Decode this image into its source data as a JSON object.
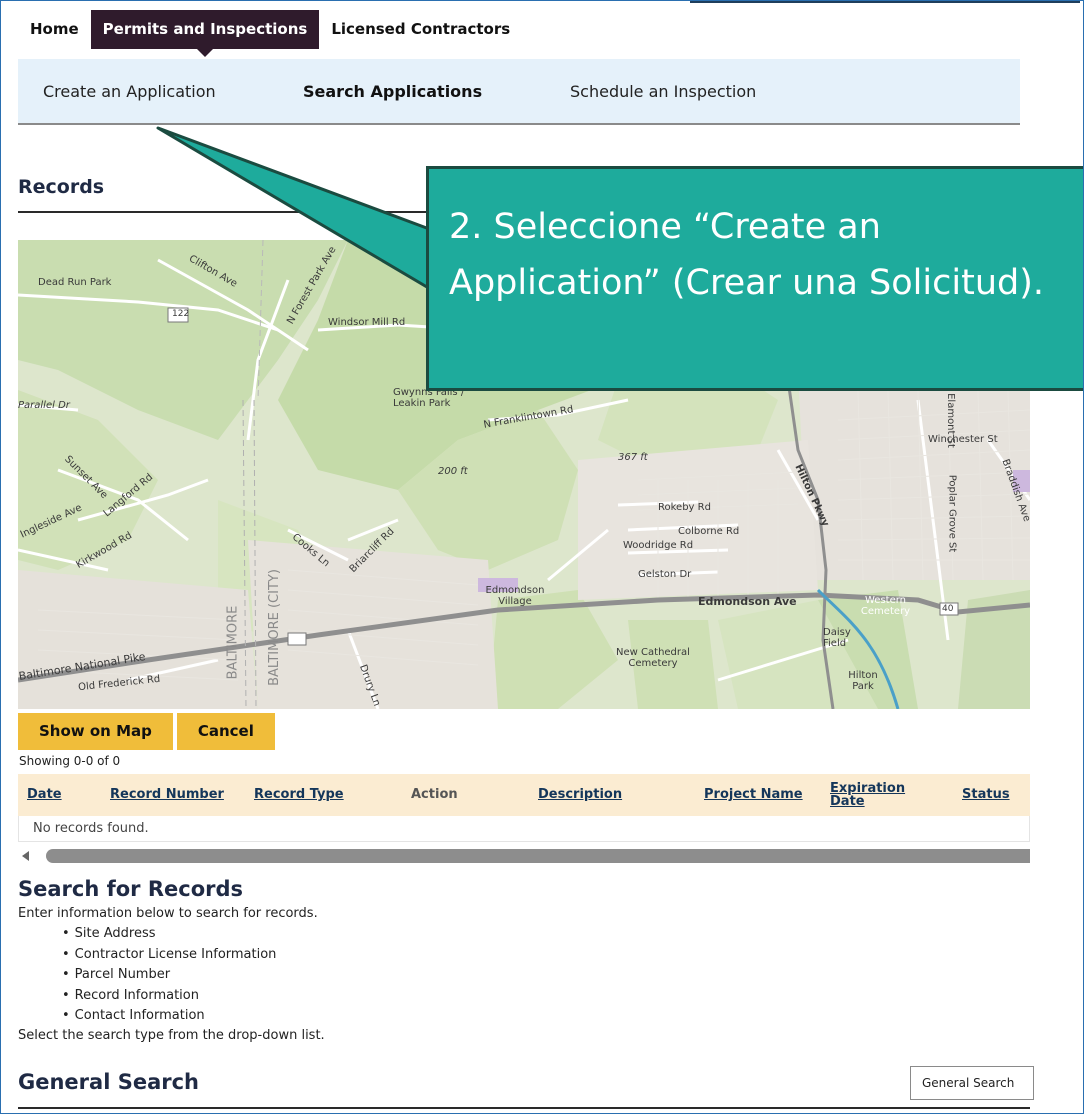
{
  "nav": {
    "home": "Home",
    "permits": "Permits and Inspections",
    "contractors": "Licensed Contractors"
  },
  "subnav": {
    "create": "Create an Application",
    "search": "Search Applications",
    "schedule": "Schedule an Inspection"
  },
  "records": {
    "title": "Records"
  },
  "callout": {
    "text": "2. Seleccione “Create an Application”  (Crear una Solicitud)."
  },
  "map": {
    "labels": [
      "Dead Run Park",
      "Clifton Ave",
      "N Forest Park Ave",
      "Windsor Mill Rd",
      "122",
      "Parallel Dr",
      "Gwynns Falls / Leakin Park",
      "N Franklintown Rd",
      "200 ft",
      "367 ft",
      "Elamont St",
      "Winchester St",
      "Sunset Ave",
      "Langford Rd",
      "Ingleside Ave",
      "Kirkwood Rd",
      "Cooks Ln",
      "Briarcliff Rd",
      "Rokeby Rd",
      "Colborne Rd",
      "Woodridge Rd",
      "Gelston Dr",
      "Hilton Pkwy",
      "Poplar Grove St",
      "Braddish Ave",
      "Edmondson Village",
      "Edmondson Ave",
      "Western Cemetery",
      "40",
      "Daisy Field",
      "New Cathedral Cemetery",
      "Hilton Park",
      "Baltimore National Pike",
      "Old Frederick Rd",
      "BALTIMORE",
      "BALTIMORE (CITY)",
      "Drury Ln"
    ]
  },
  "buttons": {
    "show_map": "Show on Map",
    "cancel": "Cancel"
  },
  "table": {
    "showing": "Showing 0-0 of 0",
    "columns": [
      "Date",
      "Record Number",
      "Record Type",
      "Action",
      "Description",
      "Project Name",
      "Expiration Date",
      "Status"
    ],
    "empty": "No records found."
  },
  "search": {
    "title": "Search for Records",
    "intro": "Enter information below to search for records.",
    "items": [
      "Site Address",
      "Contractor License Information",
      "Parcel Number",
      "Record Information",
      "Contact Information"
    ],
    "outro": "Select the search type from the drop-down list."
  },
  "general": {
    "title": "General Search",
    "select_value": "General Search"
  }
}
